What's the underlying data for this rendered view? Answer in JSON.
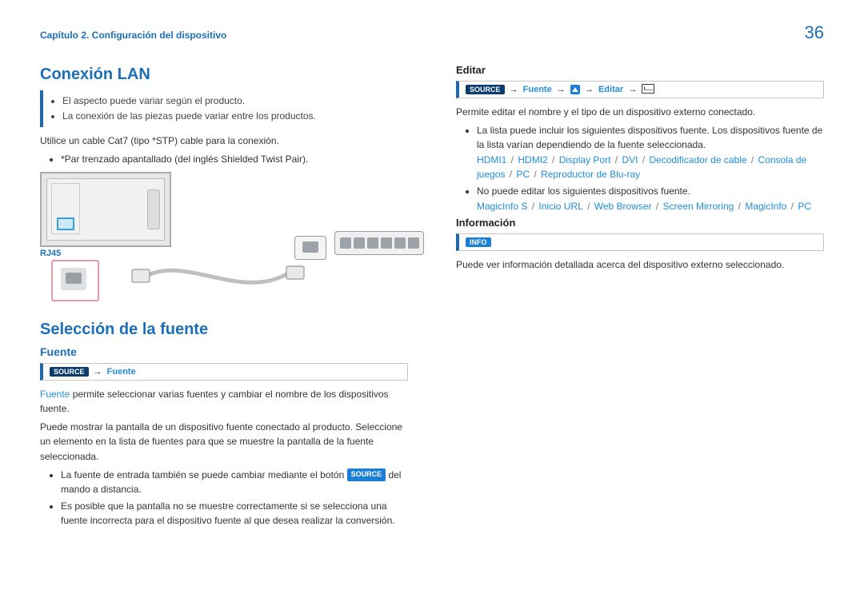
{
  "header": {
    "chapter": "Capítulo 2. Configuración del dispositivo",
    "page_number": "36"
  },
  "left": {
    "h_lan": "Conexión LAN",
    "lan_notes": [
      "El aspecto puede variar según el producto.",
      "La conexión de las piezas puede variar entre los productos."
    ],
    "lan_instr": "Utilice un cable Cat7 (tipo *STP) cable para la conexión.",
    "lan_foot": "*Par trenzado apantallado (del inglés Shielded Twist Pair).",
    "rj45": "RJ45",
    "h_sel": "Selección de la fuente",
    "h_fuente": "Fuente",
    "nav_source": "SOURCE",
    "nav_fuente": "Fuente",
    "fuente_p1a": "Fuente",
    "fuente_p1b": " permite seleccionar varias fuentes y cambiar el nombre de los dispositivos fuente.",
    "fuente_p2": "Puede mostrar la pantalla de un dispositivo fuente conectado al producto. Seleccione un elemento en la lista de fuentes para que se muestre la pantalla de la fuente seleccionada.",
    "fuente_li1a": "La fuente de entrada también se puede cambiar mediante el botón ",
    "fuente_li1b": " del mando a distancia.",
    "fuente_li2": "Es posible que la pantalla no se muestre correctamente si se selecciona una fuente incorrecta para el dispositivo fuente al que desea realizar la conversión."
  },
  "right": {
    "h_edit": "Editar",
    "nav": {
      "source": "SOURCE",
      "fuente": "Fuente",
      "editar": "Editar"
    },
    "edit_p1": "Permite editar el nombre y el tipo de un dispositivo externo conectado.",
    "edit_li1": "La lista puede incluir los siguientes dispositivos fuente. Los dispositivos fuente de la lista varían dependiendo de la fuente seleccionada.",
    "edit_list1": [
      "HDMI1",
      "HDMI2",
      "Display Port",
      "DVI",
      "Decodificador de cable",
      "Consola de juegos",
      "PC",
      "Reproductor de Blu-ray"
    ],
    "edit_li2": "No puede editar los siguientes dispositivos fuente.",
    "edit_list2": [
      "MagicInfo S",
      "Inicio URL",
      "Web Browser",
      "Screen Mirroring",
      "MagicInfo",
      "PC"
    ],
    "h_info": "Información",
    "info_pill": "INFO",
    "info_p": "Puede ver información detallada acerca del dispositivo externo seleccionado."
  }
}
